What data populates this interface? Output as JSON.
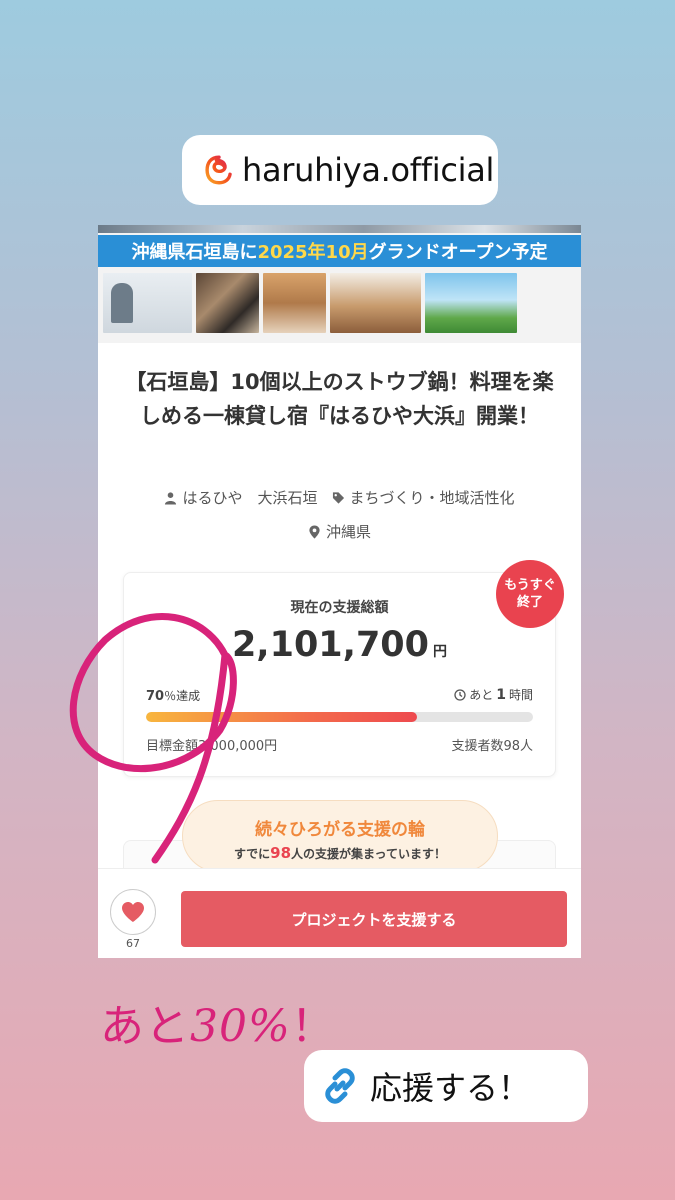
{
  "sticker_handle": {
    "text": "haruhiya.official",
    "icon": "threads-icon"
  },
  "project": {
    "banner_pre": "沖縄県石垣島に",
    "banner_highlight": "2025年10月",
    "banner_post": "グランドオープン予定",
    "title": "【石垣島】10個以上のストウブ鍋！料理を楽しめる一棟貸し宿『はるひや大浜』開業！",
    "owner": "はるひや　大浜石垣",
    "category": "まちづくり・地域活性化",
    "location": "沖縄県"
  },
  "funding": {
    "current_label": "現在の支援総額",
    "amount": "2,101,700",
    "currency": "円",
    "ending_badge_line1": "もうすぐ",
    "ending_badge_line2": "終了",
    "percent": "70",
    "percent_suffix": "％達成",
    "percent_value": 0.7,
    "time_prefix": "あと",
    "time_value": "1",
    "time_unit": "時間",
    "goal": "目標金額3,000,000円",
    "backers": "支援者数98人"
  },
  "support_pill": {
    "title": "続々ひろがる支援の輪",
    "sub_pre": "すでに",
    "count": "98",
    "sub_post": "人の支援が集まっています！"
  },
  "bottom_bar": {
    "like_count": "67",
    "support_button": "プロジェクトを支援する"
  },
  "caption": {
    "prefix": "あと",
    "value": "30%",
    "suffix": "！"
  },
  "link_sticker": {
    "text": "応援する！",
    "icon": "link-icon"
  },
  "colors": {
    "accent_red": "#e55b63",
    "badge_red": "#e9434f",
    "banner_blue": "#2a8fd6",
    "scribble_pink": "#d8237a"
  }
}
